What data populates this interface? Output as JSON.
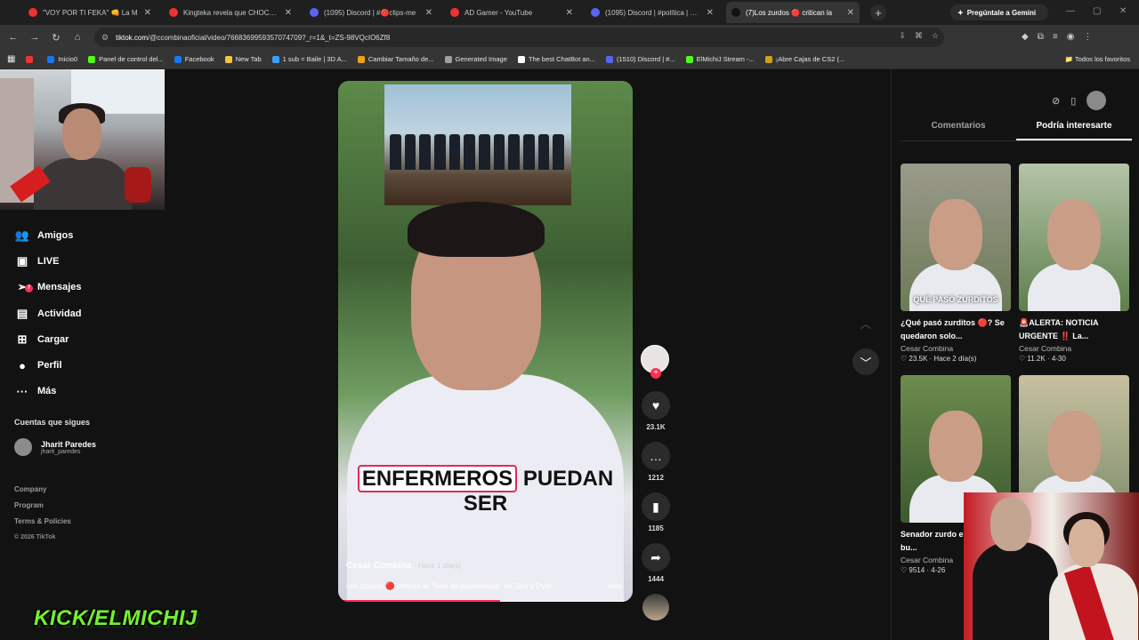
{
  "browser": {
    "tabs": [
      {
        "title": "\"VOY POR TI FEKA\" 👊 La M",
        "color": "#e33"
      },
      {
        "title": "Kingteka revela que CHOCARO",
        "color": "#e33"
      },
      {
        "title": "(1095) Discord | #🔴clips-me",
        "color": "#5865f2"
      },
      {
        "title": "AD Gamer - YouTube",
        "color": "#e33"
      },
      {
        "title": "(1095) Discord | #política | MIC",
        "color": "#5865f2"
      },
      {
        "title": "(7)Los zurdos 🔴 critican la",
        "color": "#111"
      }
    ],
    "gemini_label": "Pregúntale a Gemini",
    "url_host": "tiktok.com",
    "url_path": "/@ccombinaoficial/video/7668369959357074709?_r=1&_t=ZS-98VQcIO6Zf8",
    "bookmarks": [
      {
        "label": "",
        "color": "#e33"
      },
      {
        "label": "Inicio0",
        "color": "#1877f2"
      },
      {
        "label": "Panel de control del...",
        "color": "#53fc18"
      },
      {
        "label": "Facebook",
        "color": "#1877f2"
      },
      {
        "label": "New Tab",
        "color": "#f4c542"
      },
      {
        "label": "1 sub = Baile | 3D A...",
        "color": "#3aa0ff"
      },
      {
        "label": "Cambiar Tamaño de...",
        "color": "#e8a317"
      },
      {
        "label": "Generated Image",
        "color": "#9aa0a6"
      },
      {
        "label": "The best ChatBot an...",
        "color": "#ffffff"
      },
      {
        "label": "(1510) Discord | #...",
        "color": "#5865f2"
      },
      {
        "label": "ElMichiJ Stream -...",
        "color": "#53fc18"
      },
      {
        "label": "¡Abre Cajas de CS2 (...",
        "color": "#d4a017"
      }
    ],
    "all_bookmarks": "Todos los favoritos"
  },
  "sidebar": {
    "items": [
      {
        "label": "Amigos",
        "icon": "friends-icon",
        "glyph": "👥"
      },
      {
        "label": "LIVE",
        "icon": "live-icon",
        "glyph": "▣"
      },
      {
        "label": "Mensajes",
        "icon": "messages-icon",
        "glyph": "➢"
      },
      {
        "label": "Actividad",
        "icon": "activity-icon",
        "glyph": "▤",
        "badge": "7"
      },
      {
        "label": "Cargar",
        "icon": "upload-icon",
        "glyph": "⊞"
      },
      {
        "label": "Perfil",
        "icon": "profile-icon",
        "glyph": "●"
      },
      {
        "label": "Más",
        "icon": "more-icon",
        "glyph": "···"
      }
    ],
    "following_title": "Cuentas que sigues",
    "following": {
      "name": "Jharit Paredes",
      "handle": "jharit_paredes"
    },
    "footer": [
      "Company",
      "Program",
      "Terms & Policies"
    ],
    "copyright": "© 2026 TikTok"
  },
  "overlay_text": "KICK/ELMICHIJ",
  "video": {
    "caption_highlight": "ENFERMEROS",
    "caption_rest": "PUEDAN SER",
    "author": "Cesar Combina",
    "time": "· Hace 1 día(s)",
    "description": "Los zurdos 🔴 critican la \"falta de experiencia\" de Spa y Dyer",
    "more": "más",
    "progress": 0.55
  },
  "actions": {
    "likes": "23.1K",
    "comments": "1212",
    "saves": "1185",
    "shares": "1444"
  },
  "right_panel": {
    "tabs": [
      "Comentarios",
      "Podría interesarte"
    ],
    "active_tab": 1,
    "cards": [
      {
        "title": "¿Qué pasó zurditos 🔴? Se quedaron solo...",
        "author": "Cesar Combina",
        "stats": "♡ 23.5K · Hace 2 día(s)",
        "overlay": "QUÉ PASÓ ZURDITOS"
      },
      {
        "title": "🚨ALERTA: NOTICIA URGENTE ‼️ La...",
        "author": "Cesar Combina",
        "stats": "♡ 11.2K · 4-30",
        "overlay": ""
      },
      {
        "title": "Senador zurdo estudió y se bu...",
        "author": "Cesar Combina",
        "stats": "♡ 9514 · 4-26",
        "overlay": ""
      },
      {
        "title": "",
        "author": "",
        "stats": "",
        "overlay": ""
      }
    ]
  }
}
